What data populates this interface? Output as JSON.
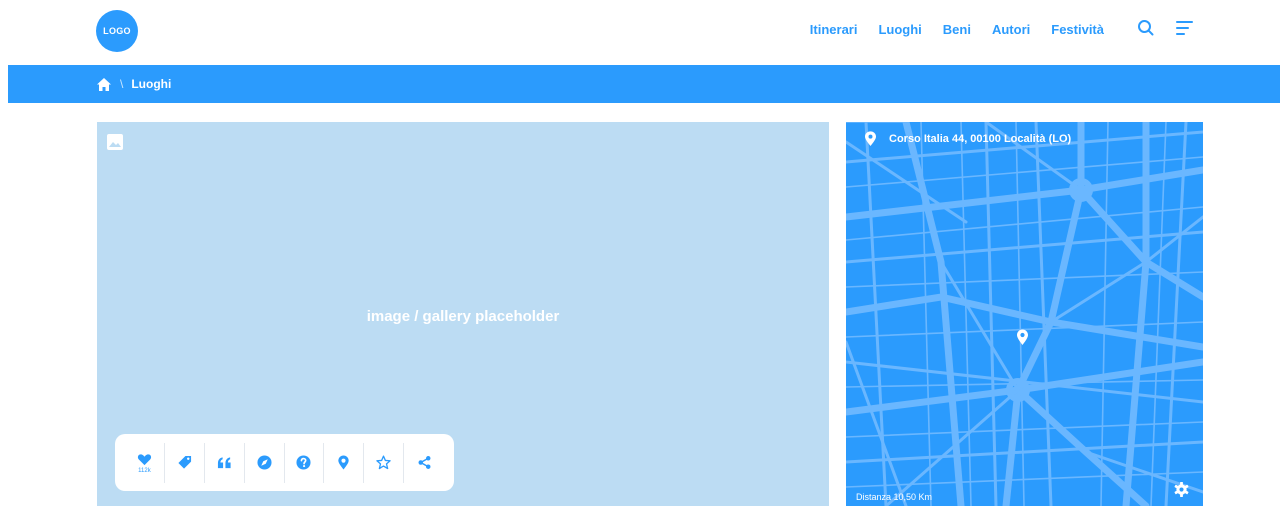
{
  "header": {
    "logo": "LOGO",
    "nav": [
      "Itinerari",
      "Luoghi",
      "Beni",
      "Autori",
      "Festività"
    ],
    "icons": [
      "search-icon",
      "menu-icon"
    ]
  },
  "breadcrumb": {
    "separator": "\\",
    "current": "Luoghi"
  },
  "gallery": {
    "placeholder": "image / gallery placeholder"
  },
  "toolbar": {
    "like_count": "112k",
    "tools": [
      "heart-icon",
      "tag-icon",
      "quote-icon",
      "compass-icon",
      "question-icon",
      "location-icon",
      "star-icon",
      "share-icon"
    ]
  },
  "map": {
    "address": "Corso Italia 44, 00100 Località (LO)",
    "distance": "Distanza 10,50 Km"
  },
  "colors": {
    "accent": "#2b9bfd",
    "gallery_bg": "#bcdcf3"
  }
}
